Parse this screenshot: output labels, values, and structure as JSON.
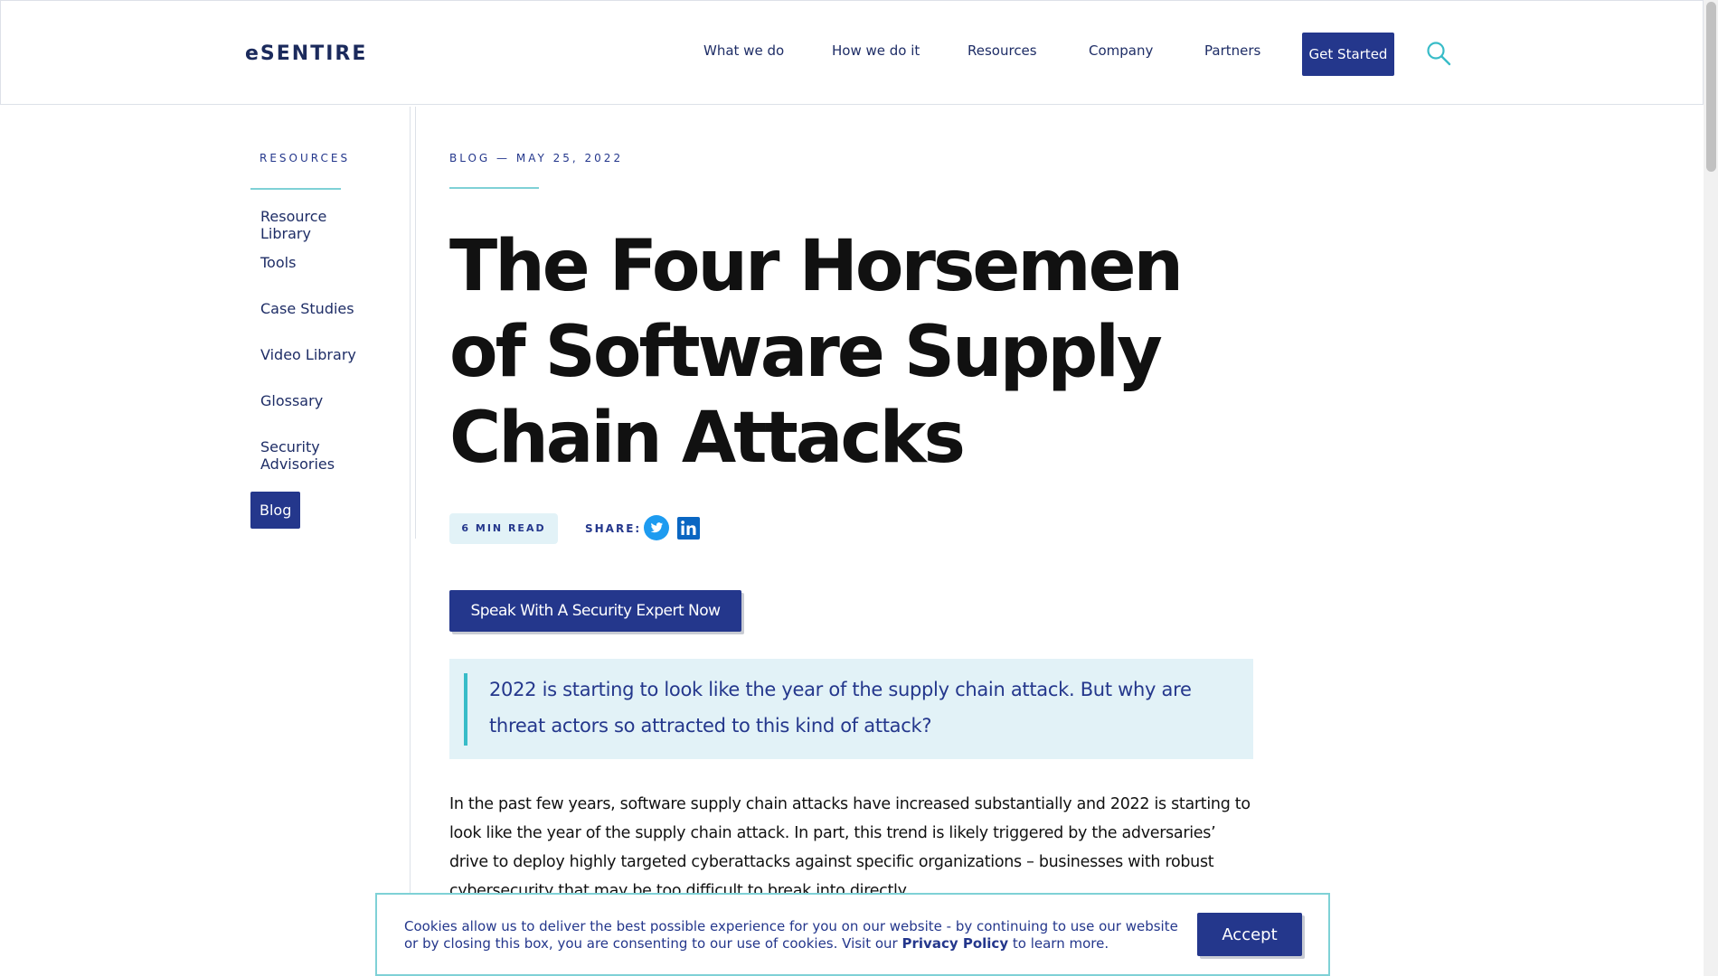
{
  "header": {
    "logo": "eSENTIRE",
    "nav": [
      "What we do",
      "How we do it",
      "Resources",
      "Company",
      "Partners"
    ],
    "cta_label": "Get Started",
    "search_icon": "search-icon"
  },
  "sidebar": {
    "heading": "RESOURCES",
    "items": [
      {
        "label": "Resource Library"
      },
      {
        "label": "Tools"
      },
      {
        "label": "Case Studies"
      },
      {
        "label": "Video Library"
      },
      {
        "label": "Glossary"
      },
      {
        "label": "Security Advisories"
      },
      {
        "label": "Blog",
        "active": true
      }
    ]
  },
  "article": {
    "meta": "BLOG — MAY 25, 2022",
    "title": "The Four Horsemen of Software Supply Chain Attacks",
    "read_time": "6 MIN READ",
    "share_label": "SHARE:",
    "share_icons": [
      "twitter-icon",
      "linkedin-icon"
    ],
    "cta_label": "Speak With A Security Expert Now",
    "quote": "2022 is starting to look like the year of the supply chain attack. But why are threat actors so attracted to this kind of attack?",
    "paragraph": "In the past few years, software supply chain attacks have increased substantially and 2022 is starting to look like the year of the supply chain attack. In part, this trend is likely triggered by the adversaries’ drive to deploy highly targeted cyberattacks against specific organizations – businesses with robust cybersecurity that may be too difficult to break into directly."
  },
  "cookie": {
    "text_before": "Cookies allow us to deliver the best possible experience for you on our website - by continuing to use our website or by closing this box, you are consenting to our use of cookies. Visit our",
    "link": "Privacy Policy",
    "text_after": "to learn more.",
    "accept_label": "Accept"
  },
  "colors": {
    "brand_navy": "#24378c",
    "accent_teal": "#7fd1d6",
    "quote_bg": "#e2f2f7",
    "text_dark": "#111111"
  }
}
